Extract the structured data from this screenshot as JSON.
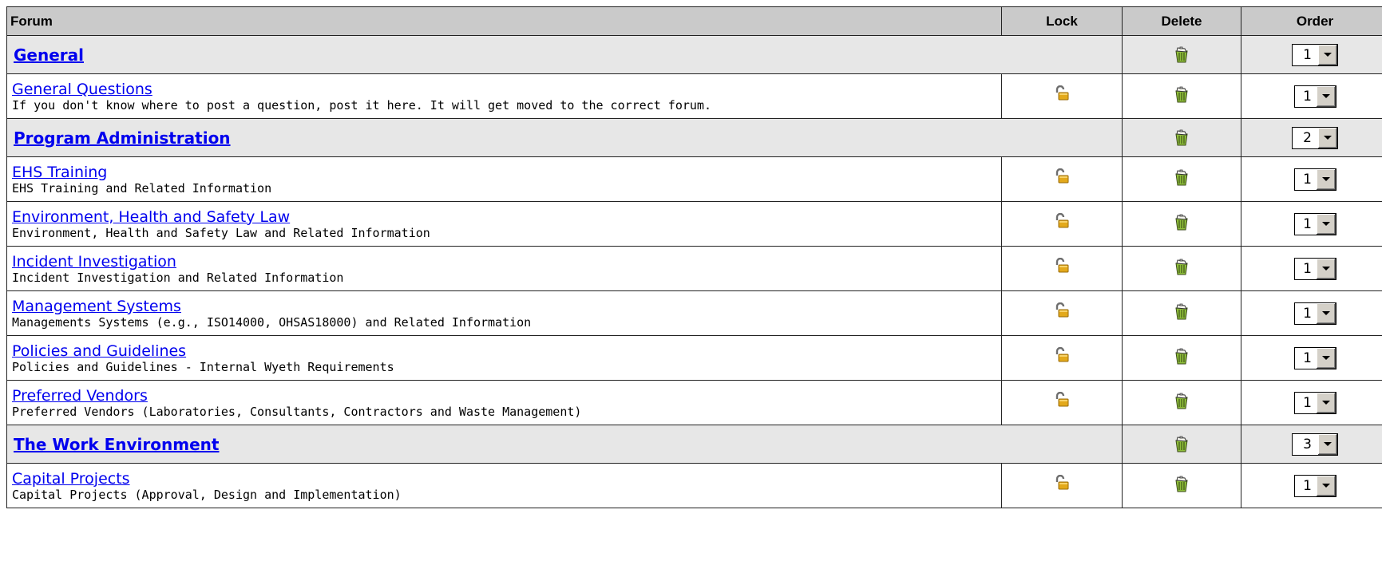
{
  "columns": {
    "forum": "Forum",
    "lock": "Lock",
    "delete": "Delete",
    "order": "Order"
  },
  "icons": {
    "lock": "lock-icon",
    "delete": "trash-icon",
    "dropdown": "chevron-down-icon"
  },
  "colors": {
    "link": "#0000ee",
    "header_bg": "#c4c4c4",
    "category_bg": "#e2e2e2",
    "lock_gold": "#e3a91b",
    "trash_green": "#8fbf3a"
  },
  "rows": [
    {
      "type": "category",
      "name": "General",
      "order": "1"
    },
    {
      "type": "forum",
      "name": "General Questions",
      "description": "If you don't know where to post a question, post it here. It will get moved to the correct forum.",
      "order": "1"
    },
    {
      "type": "category",
      "name": "Program Administration",
      "order": "2"
    },
    {
      "type": "forum",
      "name": "EHS Training",
      "description": "EHS Training and Related Information",
      "order": "1"
    },
    {
      "type": "forum",
      "name": "Environment, Health and Safety Law",
      "description": "Environment, Health and Safety Law and Related Information",
      "order": "1"
    },
    {
      "type": "forum",
      "name": "Incident Investigation",
      "description": "Incident Investigation and Related Information",
      "order": "1"
    },
    {
      "type": "forum",
      "name": "Management Systems",
      "description": "Managements Systems (e.g., ISO14000, OHSAS18000) and Related Information",
      "order": "1"
    },
    {
      "type": "forum",
      "name": "Policies and Guidelines",
      "description": "Policies and Guidelines - Internal Wyeth Requirements",
      "order": "1"
    },
    {
      "type": "forum",
      "name": "Preferred Vendors",
      "description": "Preferred Vendors (Laboratories, Consultants, Contractors and Waste Management)",
      "order": "1"
    },
    {
      "type": "category",
      "name": "The Work Environment",
      "order": "3"
    },
    {
      "type": "forum",
      "name": "Capital Projects",
      "description": "Capital Projects (Approval, Design and Implementation)",
      "order": "1"
    }
  ]
}
